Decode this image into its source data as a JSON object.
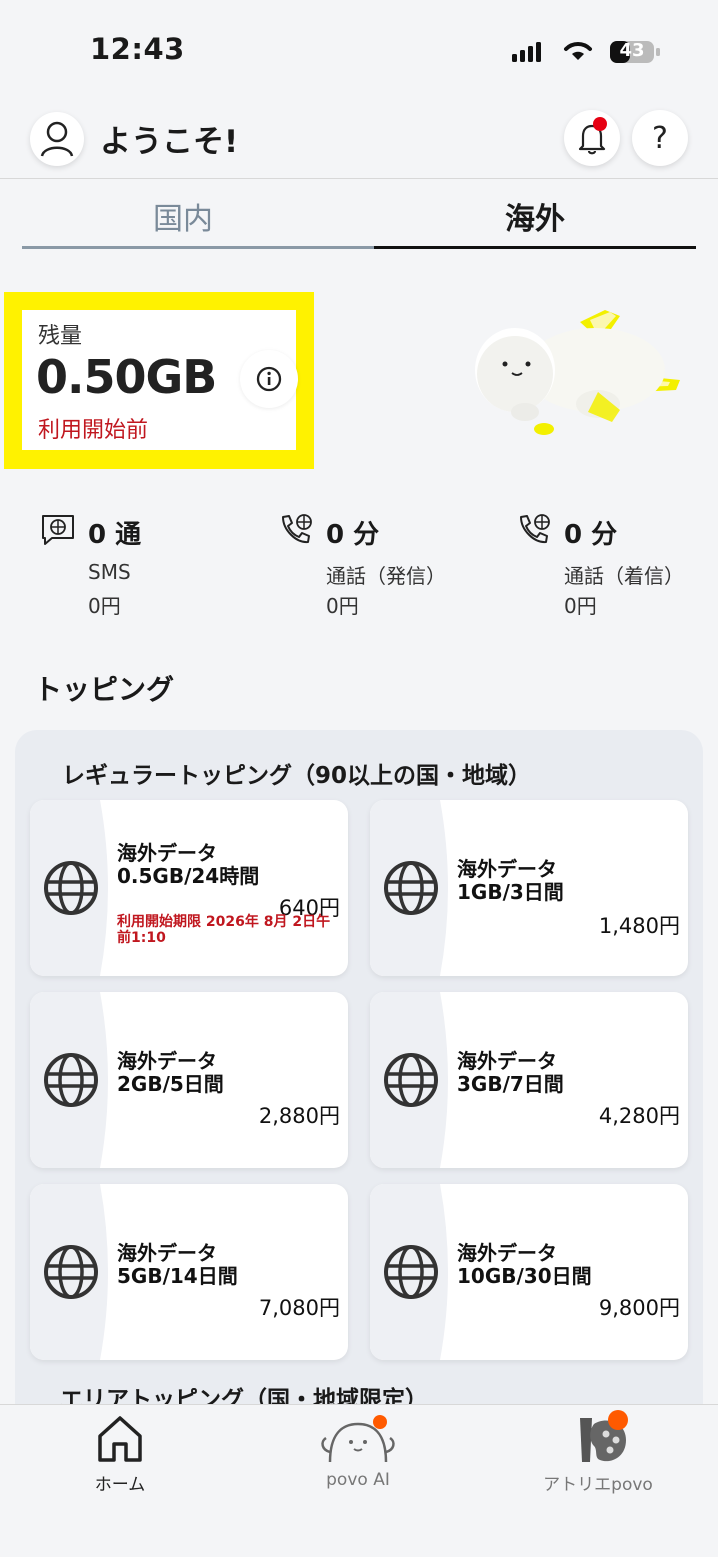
{
  "status_bar": {
    "time": "12:43",
    "battery": "43"
  },
  "header": {
    "welcome": "ようこそ!",
    "help_label": "?"
  },
  "tabs": [
    {
      "label": "国内",
      "selected": false
    },
    {
      "label": "海外",
      "selected": true
    }
  ],
  "balance": {
    "label": "残量",
    "value": "0.50GB",
    "status": "利用開始前"
  },
  "usage": [
    {
      "value": "0 通",
      "label": "SMS",
      "price": "0円",
      "icon": "sms-globe-icon"
    },
    {
      "value": "0 分",
      "label": "通話（発信）",
      "price": "0円",
      "icon": "phone-globe-icon"
    },
    {
      "value": "0 分",
      "label": "通話（着信）",
      "price": "0円",
      "icon": "phone-globe-icon"
    }
  ],
  "topping": {
    "title": "トッピング",
    "regular_title": "レギュラートッピング（90以上の国・地域）",
    "cards": [
      {
        "line1": "海外データ",
        "line2": "0.5GB/24時間",
        "price": "640円",
        "note": "利用開始期限 2026年 8月 2日午前1:10"
      },
      {
        "line1": "海外データ",
        "line2": "1GB/3日間",
        "price": "1,480円"
      },
      {
        "line1": "海外データ",
        "line2": "2GB/5日間",
        "price": "2,880円"
      },
      {
        "line1": "海外データ",
        "line2": "3GB/7日間",
        "price": "4,280円"
      },
      {
        "line1": "海外データ",
        "line2": "5GB/14日間",
        "price": "7,080円"
      },
      {
        "line1": "海外データ",
        "line2": "10GB/30日間",
        "price": "9,800円"
      }
    ],
    "area_title": "エリアトッピング（国・地域限定）"
  },
  "bottom_nav": [
    {
      "label": "ホーム",
      "active": true
    },
    {
      "label": "povo AI",
      "active": false
    },
    {
      "label": "アトリエpovo",
      "active": false
    }
  ],
  "colors": {
    "accent_yellow": "#fff200",
    "alert_red": "#c0171f",
    "notification": "#e60012",
    "orange": "#ff5a00"
  }
}
